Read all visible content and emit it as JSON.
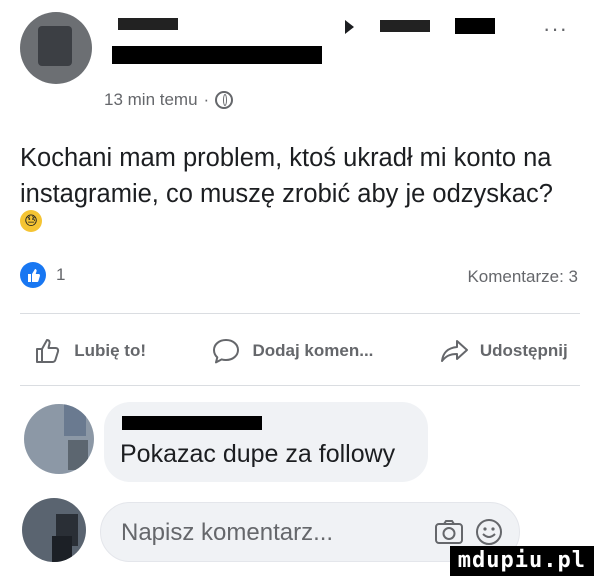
{
  "post": {
    "time": "13 min temu",
    "separator": "·",
    "text": "Kochani mam problem, ktoś ukradł mi konto na instagramie, co muszę zrobić aby je odzyskac?",
    "emoji": "😓",
    "likes": "1",
    "comments_label": "Komentarze: 3",
    "more_label": "···"
  },
  "actions": {
    "like": "Lubię to!",
    "comment": "Dodaj komen...",
    "share": "Udostępnij"
  },
  "comment": {
    "text": "Pokazac dupe za followy"
  },
  "composer": {
    "placeholder": "Napisz komentarz..."
  },
  "watermark": "mdupiu.pl",
  "colors": {
    "brand": "#1877f2",
    "muted": "#65676b",
    "bubble": "#f0f2f5"
  }
}
